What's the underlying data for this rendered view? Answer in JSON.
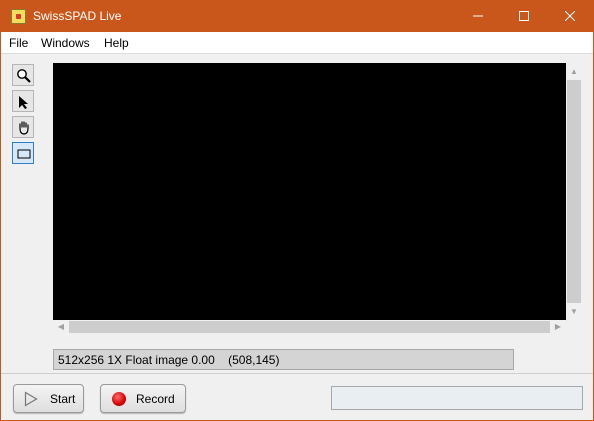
{
  "window": {
    "title": "SwissSPAD Live",
    "accent_color": "#c9561a",
    "app_icon": "swissspad-app-icon"
  },
  "menu": {
    "items": [
      "File",
      "Windows",
      "Help"
    ]
  },
  "tools": [
    {
      "name": "zoom-icon",
      "selected": false
    },
    {
      "name": "pointer-icon",
      "selected": false
    },
    {
      "name": "pan-hand-icon",
      "selected": false
    },
    {
      "name": "rectangle-select-icon",
      "selected": true
    }
  ],
  "image_info": "512x256 1X Float image 0.00    (508,145)",
  "buttons": {
    "start_label": "Start",
    "record_label": "Record",
    "start_icon": "play-icon",
    "record_icon": "record-dot-icon"
  },
  "status_field": ""
}
